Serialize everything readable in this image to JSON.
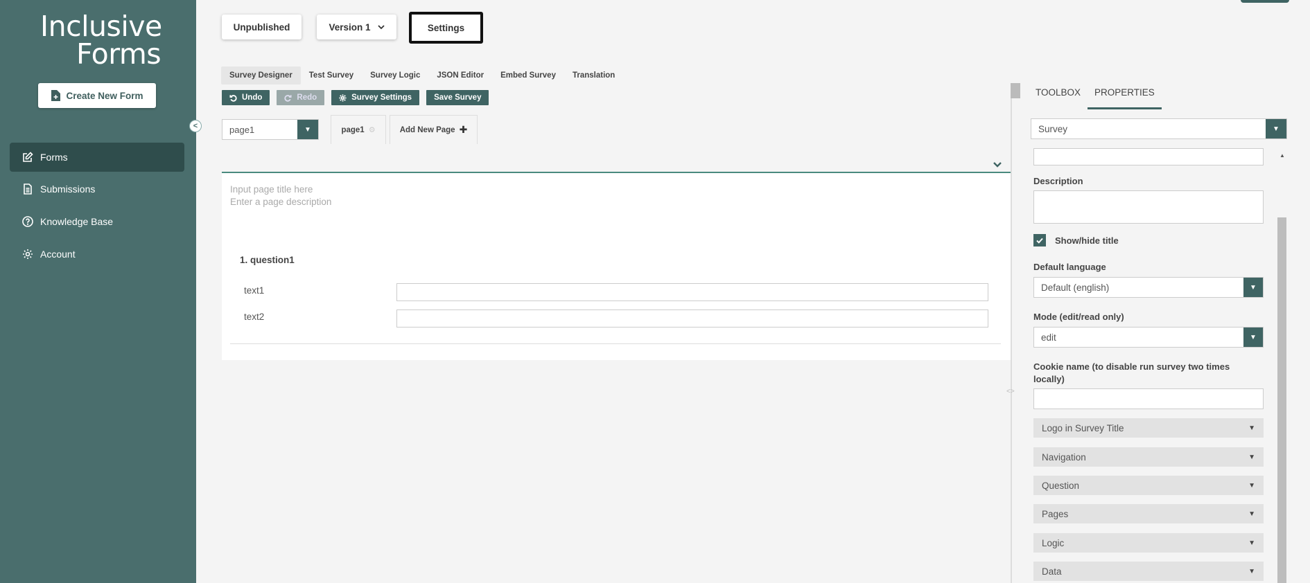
{
  "sidebar": {
    "logo_line1": "Inclusive",
    "logo_line2": "Forms",
    "create_label": "Create New Form",
    "collapse_glyph": "<",
    "items": [
      {
        "label": "Forms",
        "icon": "edit-icon"
      },
      {
        "label": "Submissions",
        "icon": "document-icon"
      },
      {
        "label": "Knowledge Base",
        "icon": "help-circle-icon"
      },
      {
        "label": "Account",
        "icon": "gear-icon"
      }
    ]
  },
  "header": {
    "status_label": "Unpublished",
    "version_label": "Version 1",
    "settings_label": "Settings"
  },
  "tabs": [
    "Survey Designer",
    "Test Survey",
    "Survey Logic",
    "JSON Editor",
    "Embed Survey",
    "Translation"
  ],
  "toolbar": {
    "undo": "Undo",
    "redo": "Redo",
    "survey_settings": "Survey Settings",
    "save": "Save Survey"
  },
  "pages": {
    "selected": "page1",
    "tab_label": "page1",
    "add_label": "Add New Page"
  },
  "design": {
    "title_placeholder": "Input page title here",
    "desc_placeholder": "Enter a page description",
    "question_title": "1. question1",
    "rows": [
      "text1",
      "text2"
    ]
  },
  "panel": {
    "tabs": [
      "TOOLBOX",
      "PROPERTIES"
    ],
    "selected_object": "Survey",
    "description_label": "Description",
    "show_title_label": "Show/hide title",
    "show_title_checked": true,
    "default_language_label": "Default language",
    "default_language_value": "Default (english)",
    "mode_label": "Mode (edit/read only)",
    "mode_value": "edit",
    "cookie_label": "Cookie name (to disable run survey two times locally)",
    "sections": [
      "Logo in Survey Title",
      "Navigation",
      "Question",
      "Pages",
      "Logic",
      "Data"
    ]
  },
  "colors": {
    "sidebar": "#4a6e6d",
    "accent": "#3f6463"
  }
}
